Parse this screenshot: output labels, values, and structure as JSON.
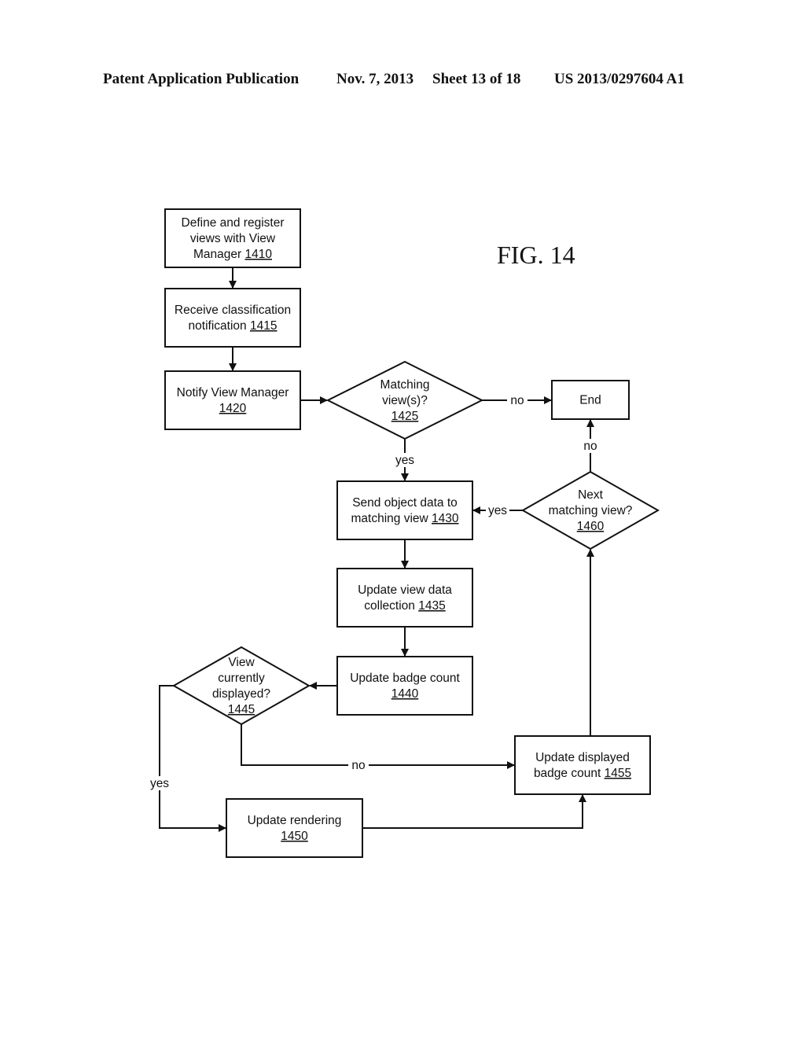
{
  "header": {
    "publication": "Patent Application Publication",
    "date": "Nov. 7, 2013",
    "sheet": "Sheet 13 of 18",
    "number": "US 2013/0297604 A1"
  },
  "figure_label": "FIG. 14",
  "nodes": {
    "n1410": {
      "lines": [
        "Define and register",
        "views with View",
        "Manager "
      ],
      "ref": "1410"
    },
    "n1415": {
      "lines": [
        "Receive classification",
        "notification "
      ],
      "ref": "1415"
    },
    "n1420": {
      "lines": [
        "Notify View Manager"
      ],
      "ref": "1420"
    },
    "n1425": {
      "lines": [
        "Matching",
        "view(s)?"
      ],
      "ref": "1425"
    },
    "end": {
      "lines": [
        "End"
      ],
      "ref": ""
    },
    "n1430": {
      "lines": [
        "Send object data to",
        "matching view "
      ],
      "ref": "1430"
    },
    "n1460": {
      "lines": [
        "Next",
        "matching view?"
      ],
      "ref": "1460"
    },
    "n1435": {
      "lines": [
        "Update view data",
        "collection "
      ],
      "ref": "1435"
    },
    "n1440": {
      "lines": [
        "Update badge count"
      ],
      "ref": "1440"
    },
    "n1445": {
      "lines": [
        "View",
        "currently",
        "displayed?"
      ],
      "ref": "1445"
    },
    "n1455": {
      "lines": [
        "Update displayed",
        "badge count "
      ],
      "ref": "1455"
    },
    "n1450": {
      "lines": [
        "Update rendering"
      ],
      "ref": "1450"
    }
  },
  "edge_labels": {
    "e1425_no": "no",
    "e1425_yes": "yes",
    "e1460_no": "no",
    "e1460_yes": "yes",
    "e1445_no": "no",
    "e1445_yes": "yes"
  }
}
